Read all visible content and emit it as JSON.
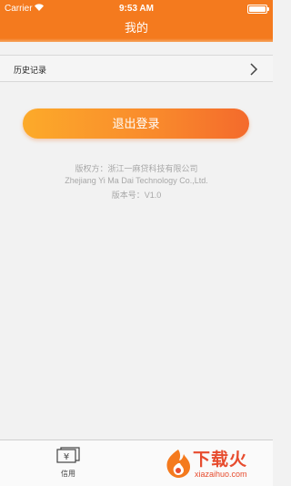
{
  "status_bar": {
    "carrier": "Carrier",
    "time": "9:53 AM",
    "wifi_icon": "wifi-icon",
    "battery_icon": "battery-icon"
  },
  "nav": {
    "title": "我的"
  },
  "history": {
    "label": "历史记录",
    "chevron_icon": "chevron-right-icon"
  },
  "logout": {
    "label": "退出登录"
  },
  "info": {
    "copyright": "版权方：浙江一麻贷科技有限公司",
    "company_en": "Zhejiang Yi Ma Dai Technology Co.,Ltd.",
    "version": "版本号：V1.0"
  },
  "tab_bar": {
    "items": [
      {
        "label": "信用",
        "icon": "credit-card-icon"
      }
    ]
  },
  "watermark": {
    "main_text": "下载火",
    "sub_text": "xiazaihuo.com"
  },
  "colors": {
    "brand": "#f47a1e",
    "button_start": "#fcaa2a",
    "button_end": "#f46a2c",
    "background": "#f2f2f2",
    "info_text": "#a8a8a8",
    "watermark": "#e74c2e"
  }
}
